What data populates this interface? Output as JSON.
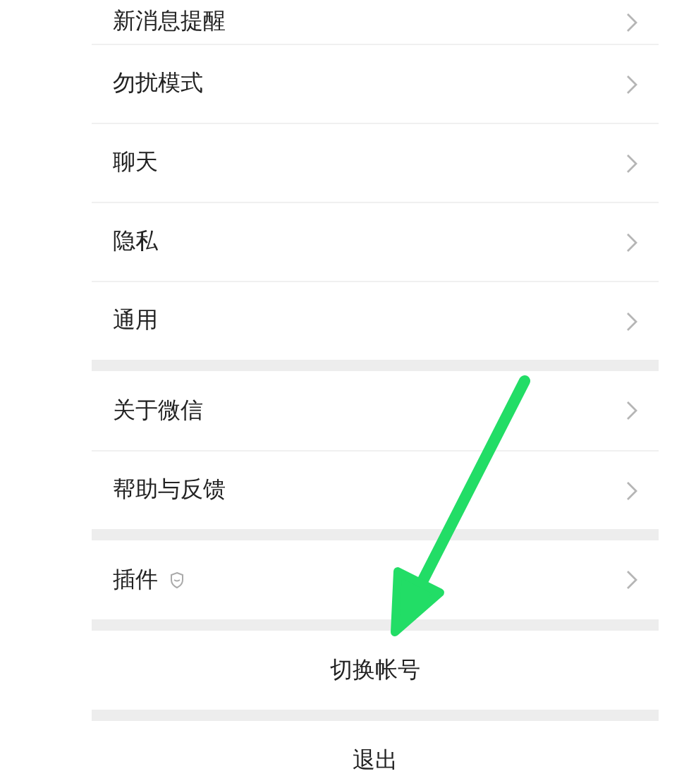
{
  "groups": [
    {
      "items": [
        {
          "kind": "link",
          "label": "新消息提醒"
        },
        {
          "kind": "link",
          "label": "勿扰模式"
        },
        {
          "kind": "link",
          "label": "聊天"
        },
        {
          "kind": "link",
          "label": "隐私"
        },
        {
          "kind": "link",
          "label": "通用"
        }
      ]
    },
    {
      "items": [
        {
          "kind": "link",
          "label": "关于微信"
        },
        {
          "kind": "link",
          "label": "帮助与反馈"
        }
      ]
    },
    {
      "items": [
        {
          "kind": "link_badge",
          "label": "插件"
        }
      ]
    },
    {
      "items": [
        {
          "kind": "action",
          "label": "切换帐号"
        }
      ]
    },
    {
      "items": [
        {
          "kind": "action",
          "label": "退出"
        }
      ]
    }
  ],
  "annotation": {
    "kind": "arrow",
    "color": "#22dd66"
  }
}
